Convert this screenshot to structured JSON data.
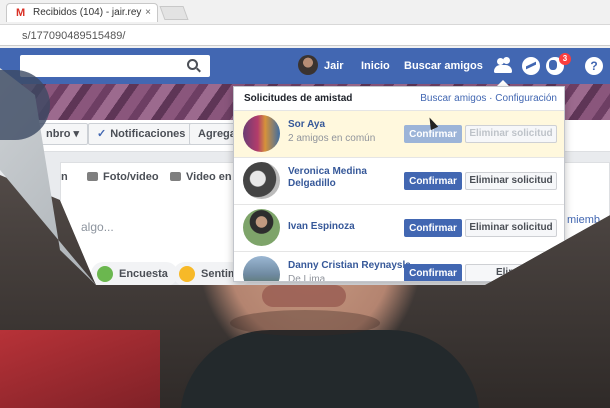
{
  "browser": {
    "tab_title": "Recibidos (104) - jair.rey",
    "tab_close": "×",
    "gmail_glyph": "M",
    "address": "s/177090489515489/"
  },
  "topbar": {
    "user_name": "Jair",
    "home": "Inicio",
    "find_friends": "Buscar amigos",
    "notification_count": "3",
    "help": "?",
    "icons": [
      "friends-icon",
      "messenger-icon",
      "globe-notifications-icon",
      "help-icon"
    ]
  },
  "profile_bar": {
    "member_label": "nbro ▾",
    "notifications_label": "Notificaciones",
    "add_label": "Agregar"
  },
  "composer": {
    "tab_partial": "n",
    "photo_video": "Foto/video",
    "live_video": "Video en vi",
    "placeholder": "algo...",
    "poll": "Encuesta",
    "feeling": "Sentimi",
    "right_link": "miemb"
  },
  "friend_requests": {
    "title": "Solicitudes de amistad",
    "find_friends_link": "Buscar amigos",
    "separator": " · ",
    "settings_link": "Configuración",
    "requests": [
      {
        "name": "Sor Aya",
        "subtitle": "2 amigos en común",
        "confirm": "Confirmar",
        "delete": "Eliminar solicitud",
        "state": "pending-disabled"
      },
      {
        "name": "Veronica Medina Delgadillo",
        "subtitle": "",
        "confirm": "Confirmar",
        "delete": "Eliminar solicitud",
        "state": "active"
      },
      {
        "name": "Ivan Espinoza",
        "subtitle": "",
        "confirm": "Confirmar",
        "delete": "Eliminar solicitud",
        "state": "active"
      },
      {
        "name": "Danny Cristian Reynaysla",
        "subtitle": "De Lima",
        "confirm": "Confirmar",
        "delete": "Elimin",
        "state": "active"
      }
    ]
  },
  "colors": {
    "facebook_blue": "#4267b2",
    "highlight_row": "#fff8dd",
    "link": "#365899"
  }
}
